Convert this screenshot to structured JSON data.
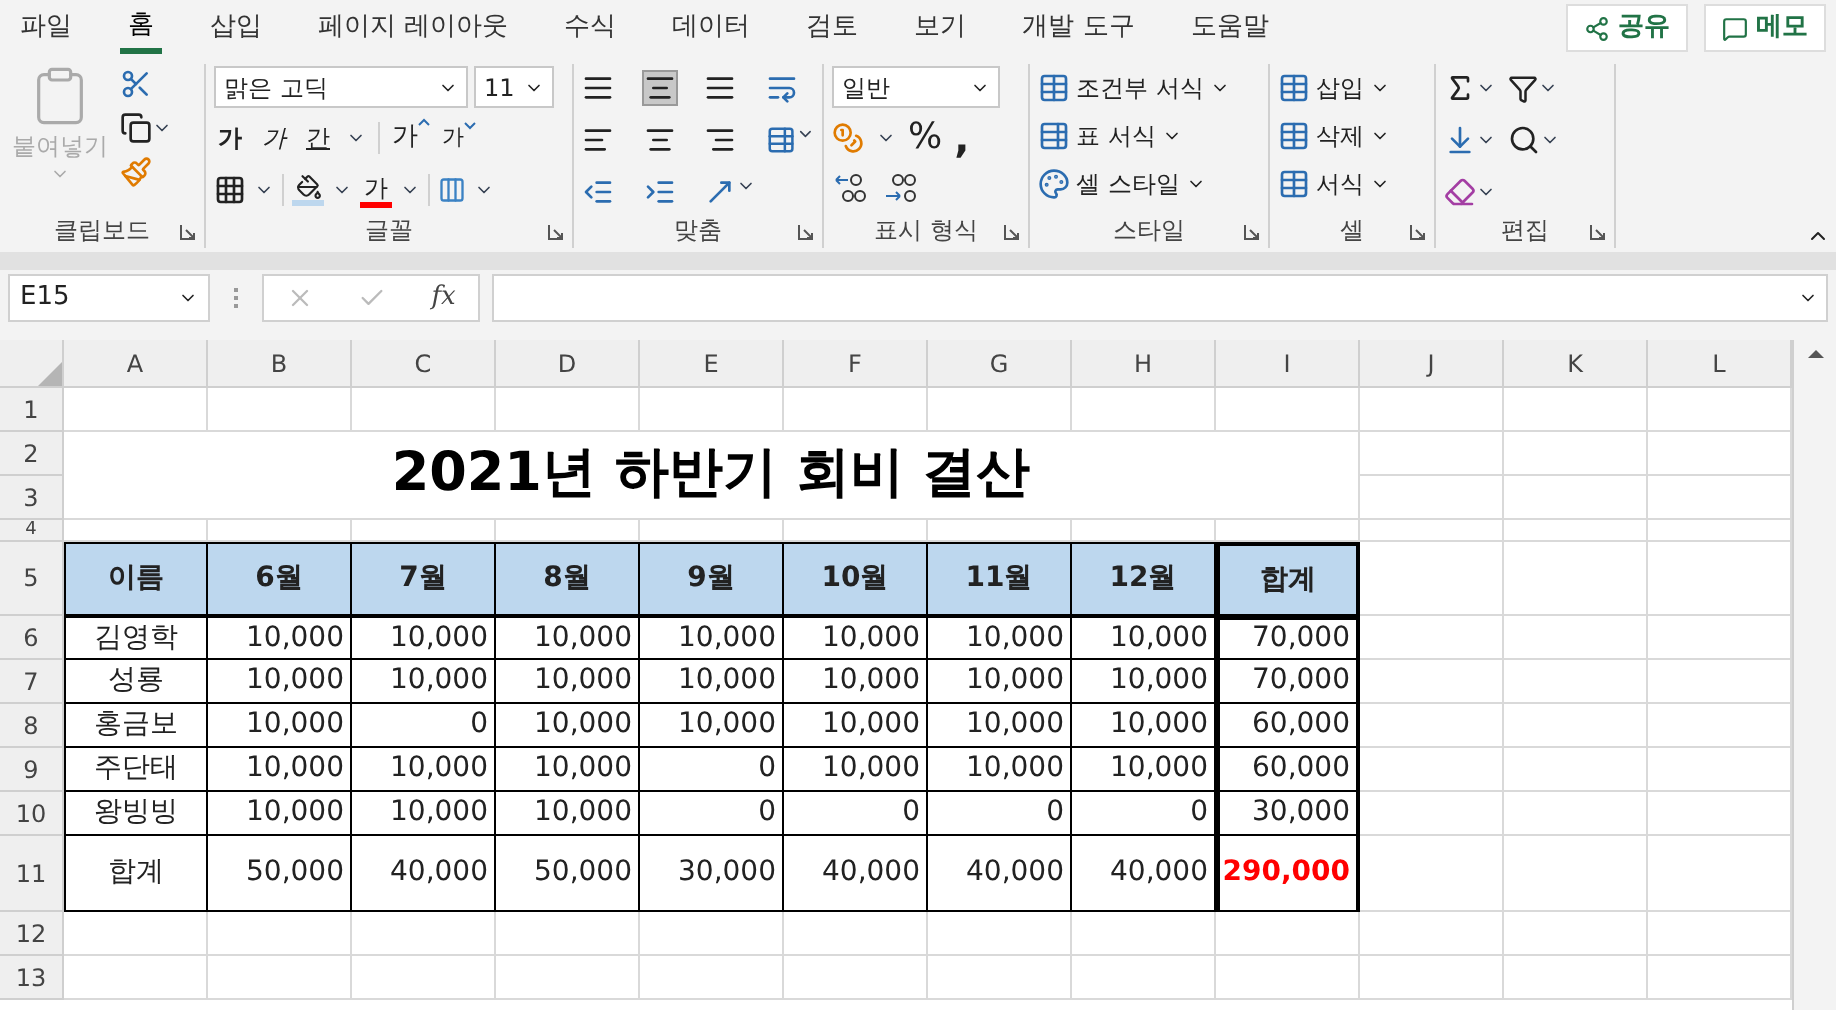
{
  "menu_tabs": [
    {
      "label": "파일",
      "selected": false
    },
    {
      "label": "홈",
      "selected": true
    },
    {
      "label": "삽입",
      "selected": false
    },
    {
      "label": "페이지 레이아웃",
      "selected": false
    },
    {
      "label": "수식",
      "selected": false
    },
    {
      "label": "데이터",
      "selected": false
    },
    {
      "label": "검토",
      "selected": false
    },
    {
      "label": "보기",
      "selected": false
    },
    {
      "label": "개발 도구",
      "selected": false
    },
    {
      "label": "도움말",
      "selected": false
    }
  ],
  "share_button": "공유",
  "comments_button": "메모",
  "ribbon": {
    "clipboard": {
      "label": "클립보드",
      "paste": "붙여넣기"
    },
    "font": {
      "label": "글꼴",
      "font_name": "맑은 고딕",
      "font_size": "11",
      "bold": "가",
      "italic": "가",
      "underline": "간",
      "grow": "가",
      "shrink": "가",
      "font_color": "가"
    },
    "alignment": {
      "label": "맞춤"
    },
    "number": {
      "label": "표시 형식",
      "format": "일반",
      "percent": "%",
      "comma": ","
    },
    "styles": {
      "label": "스타일",
      "items": [
        "조건부 서식",
        "표 서식",
        "셀 스타일"
      ]
    },
    "cells": {
      "label": "셀",
      "items": [
        "삽입",
        "삭제",
        "서식"
      ]
    },
    "editing": {
      "label": "편집"
    }
  },
  "formula_bar": {
    "name_box": "E15",
    "fx": "fx"
  },
  "sheet": {
    "columns": [
      "A",
      "B",
      "C",
      "D",
      "E",
      "F",
      "G",
      "H",
      "I",
      "J",
      "K",
      "L"
    ],
    "row_numbers": [
      "1",
      "2",
      "3",
      "4",
      "5",
      "6",
      "7",
      "8",
      "9",
      "10",
      "11",
      "12",
      "13"
    ],
    "title": "2021년 하반기 회비 결산",
    "header": [
      "이름",
      "6월",
      "7월",
      "8월",
      "9월",
      "10월",
      "11월",
      "12월",
      "합계"
    ],
    "rows": [
      {
        "name": "김영학",
        "values": [
          "10,000",
          "10,000",
          "10,000",
          "10,000",
          "10,000",
          "10,000",
          "10,000"
        ],
        "total": "70,000"
      },
      {
        "name": "성룡",
        "values": [
          "10,000",
          "10,000",
          "10,000",
          "10,000",
          "10,000",
          "10,000",
          "10,000"
        ],
        "total": "70,000"
      },
      {
        "name": "홍금보",
        "values": [
          "10,000",
          "0",
          "10,000",
          "10,000",
          "10,000",
          "10,000",
          "10,000"
        ],
        "total": "60,000"
      },
      {
        "name": "주단태",
        "values": [
          "10,000",
          "10,000",
          "10,000",
          "0",
          "10,000",
          "10,000",
          "10,000"
        ],
        "total": "60,000"
      },
      {
        "name": "왕빙빙",
        "values": [
          "10,000",
          "10,000",
          "10,000",
          "0",
          "0",
          "0",
          "0"
        ],
        "total": "30,000"
      }
    ],
    "sum_row": {
      "label": "합계",
      "values": [
        "50,000",
        "40,000",
        "50,000",
        "30,000",
        "40,000",
        "40,000",
        "40,000"
      ],
      "total": "290,000"
    }
  }
}
